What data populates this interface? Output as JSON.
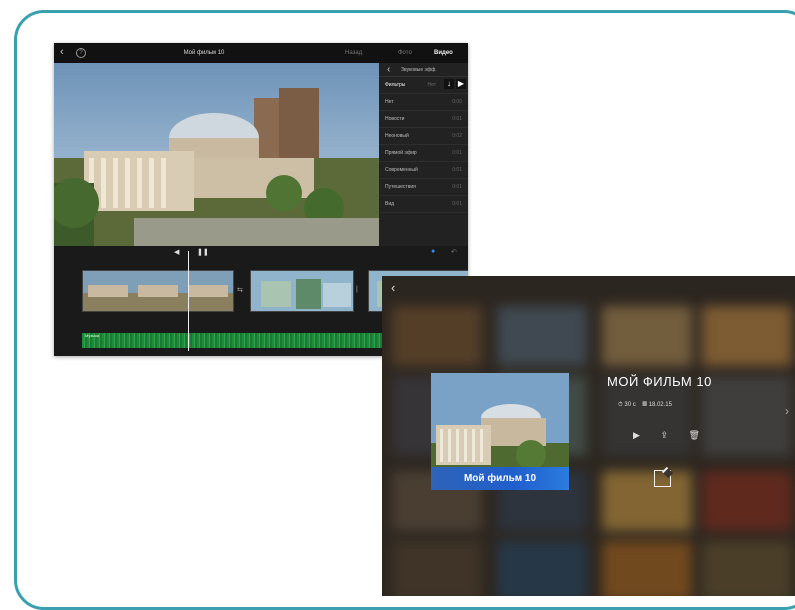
{
  "editor": {
    "window_title": "Мой фильм 10",
    "top_tabs": [
      "Назад",
      "Фото",
      "Видео"
    ],
    "panel": {
      "title": "Звуковые эфф.",
      "rows": [
        {
          "label": "Фильтры",
          "value": "Нет"
        },
        {
          "label": "Нет",
          "value": "0:00"
        },
        {
          "label": "Новости",
          "value": "0:01"
        },
        {
          "label": "Неоновый",
          "value": "0:02"
        },
        {
          "label": "Прямой эфир",
          "value": "0:01"
        },
        {
          "label": "Современный",
          "value": "0:01"
        },
        {
          "label": "Путешествия",
          "value": "0:01"
        },
        {
          "label": "Вид",
          "value": "0:01"
        }
      ]
    },
    "audio_track_label": "Музыка"
  },
  "project": {
    "title": "МОЙ ФИЛЬМ 10",
    "thumbnail_label": "Мой фильм 10",
    "duration": "30 с",
    "date": "18.02.15"
  }
}
